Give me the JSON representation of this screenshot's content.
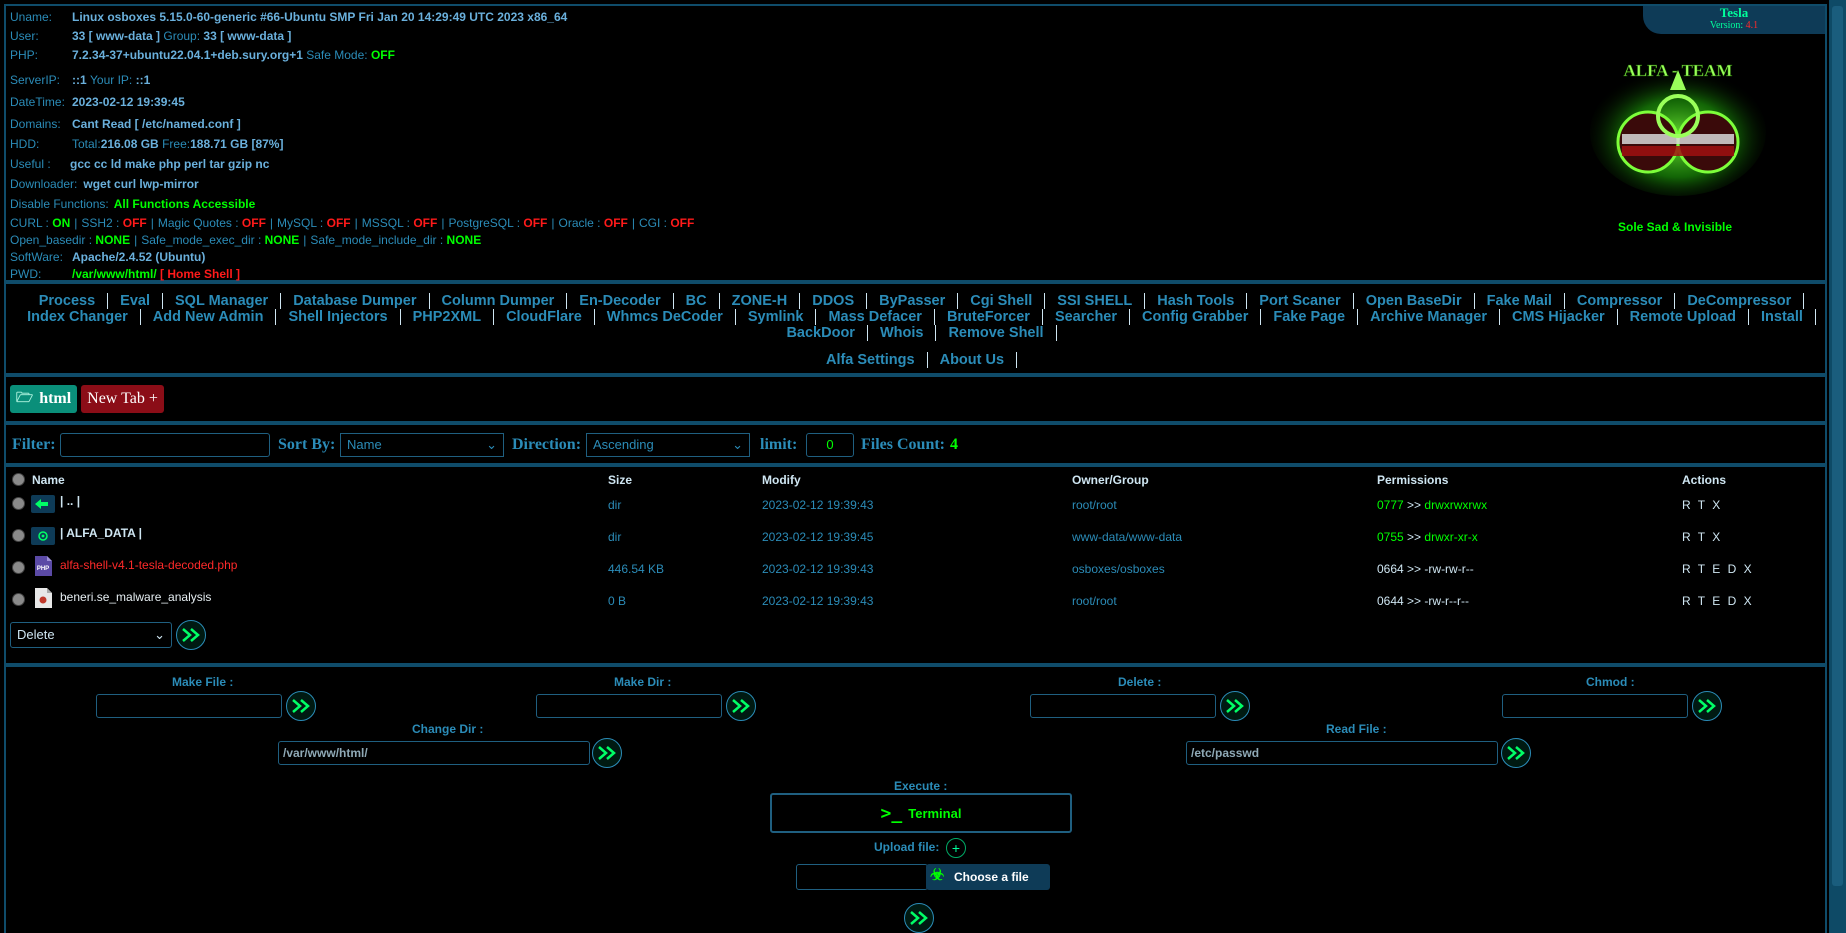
{
  "header": {
    "uname_label": "Uname:",
    "uname": "Linux osboxes 5.15.0-60-generic #66-Ubuntu SMP Fri Jan 20 14:29:49 UTC 2023 x86_64",
    "user_label": "User:",
    "user": "33 [ www-data ]",
    "group_label": "Group:",
    "group": "33 [ www-data ]",
    "php_label": "PHP:",
    "php": "7.2.34-37+ubuntu22.04.1+deb.sury.org+1",
    "safe_mode_label": "Safe Mode:",
    "safe_mode": "OFF",
    "serverip_label": "ServerIP:",
    "serverip": "::1",
    "yourip_label": "Your IP:",
    "yourip": "::1",
    "datetime_label": "DateTime:",
    "datetime": "2023-02-12 19:39:45",
    "domains_label": "Domains:",
    "domains": "Cant Read [ /etc/named.conf ]",
    "hdd_label": "HDD:",
    "hdd_total_label": "Total:",
    "hdd_total": "216.08 GB",
    "hdd_free_label": "Free:",
    "hdd_free": "188.71 GB [87%]",
    "useful_label": "Useful :",
    "useful": "gcc cc ld make php perl tar gzip nc",
    "downloader_label": "Downloader:",
    "downloader": "wget curl lwp-mirror",
    "disable_label": "Disable Functions:",
    "disable": "All Functions Accessible",
    "curl_label": "CURL :",
    "curl": "ON",
    "ssh2_label": "SSH2 :",
    "ssh2": "OFF",
    "magic_label": "Magic Quotes :",
    "magic": "OFF",
    "mysql_label": "MySQL :",
    "mysql": "OFF",
    "mssql_label": "MSSQL :",
    "mssql": "OFF",
    "pgsql_label": "PostgreSQL :",
    "pgsql": "OFF",
    "oracle_label": "Oracle :",
    "oracle": "OFF",
    "cgi_label": "CGI :",
    "cgi": "OFF",
    "openbd_label": "Open_basedir :",
    "openbd": "NONE",
    "exec_label": "Safe_mode_exec_dir :",
    "exec": "NONE",
    "include_label": "Safe_mode_include_dir :",
    "include": "NONE",
    "software_label": "SoftWare:",
    "software": "Apache/2.4.52 (Ubuntu)",
    "pwd_label": "PWD:",
    "pwd": "/var/www/html/",
    "home_shell": "[ Home Shell ]",
    "tesla": "Tesla",
    "version_label": "Version:",
    "version": "4.1",
    "logo_text": "ALFA - TEAM",
    "slogan": "Sole Sad & Invisible"
  },
  "menu": {
    "line1": [
      "Process",
      "Eval",
      "SQL Manager",
      "Database Dumper",
      "Column Dumper",
      "En-Decoder",
      "BC",
      "ZONE-H",
      "DDOS",
      "ByPasser",
      "Cgi Shell",
      "SSI SHELL",
      "Hash Tools",
      "Port Scaner",
      "Open BaseDir",
      "Fake Mail",
      "Compressor",
      "DeCompressor"
    ],
    "line2": [
      "Index Changer",
      "Add New Admin",
      "Shell Injectors",
      "PHP2XML",
      "CloudFlare",
      "Whmcs DeCoder",
      "Symlink",
      "Mass Defacer",
      "BruteForcer",
      "Searcher",
      "Config Grabber",
      "Fake Page",
      "Archive Manager",
      "CMS Hijacker",
      "Remote Upload",
      "Install"
    ],
    "line3": [
      "BackDoor",
      "Whois",
      "Remove Shell"
    ],
    "line4": [
      "Alfa Settings",
      "About Us"
    ]
  },
  "tabs": {
    "current": "html",
    "new_tab": "New Tab +"
  },
  "filter": {
    "filter_label": "Filter:",
    "sort_label": "Sort By:",
    "sort_value": "Name",
    "direction_label": "Direction:",
    "direction_value": "Ascending",
    "limit_label": "limit:",
    "limit_value": "0",
    "count_label": "Files Count:",
    "count_value": "4"
  },
  "table": {
    "headers": {
      "name": "Name",
      "size": "Size",
      "modify": "Modify",
      "owner": "Owner/Group",
      "perms": "Permissions",
      "actions": "Actions"
    },
    "rows": [
      {
        "name": "| .. |",
        "size": "dir",
        "modify": "2023-02-12 19:39:43",
        "owner": "root/root",
        "perm_oct": "0777",
        "perm_sep": ">>",
        "perm_str": "drwxrwxrwx",
        "actions": "R T X"
      },
      {
        "name": "| ALFA_DATA |",
        "size": "dir",
        "modify": "2023-02-12 19:39:45",
        "owner": "www-data/www-data",
        "perm_oct": "0755",
        "perm_sep": ">>",
        "perm_str": "drwxr-xr-x",
        "actions": "R T X"
      },
      {
        "name": "alfa-shell-v4.1-tesla-decoded.php",
        "size": "446.54 KB",
        "modify": "2023-02-12 19:39:43",
        "owner": "osboxes/osboxes",
        "perm_oct": "0664",
        "perm_sep": ">>",
        "perm_str": "-rw-rw-r--",
        "actions": "R T E D X"
      },
      {
        "name": "beneri.se_malware_analysis",
        "size": "0 B",
        "modify": "2023-02-12 19:39:43",
        "owner": "root/root",
        "perm_oct": "0644",
        "perm_sep": ">>",
        "perm_str": "-rw-r--r--",
        "actions": "R T E D X"
      }
    ],
    "bulk_action": "Delete"
  },
  "tools": {
    "make_file_label": "Make File :",
    "make_dir_label": "Make Dir :",
    "delete_label": "Delete :",
    "chmod_label": "Chmod :",
    "change_dir_label": "Change Dir :",
    "change_dir_value": "/var/www/html/",
    "read_file_label": "Read File :",
    "read_file_value": "/etc/passwd",
    "execute_label": "Execute :",
    "terminal_label": "Terminal",
    "upload_label": "Upload file:",
    "choose_label": "Choose a file"
  },
  "colors": {
    "accent": "#2b8cb8",
    "on": "#00ff00",
    "off": "#ff1a1a",
    "border": "#0f4c6a"
  }
}
